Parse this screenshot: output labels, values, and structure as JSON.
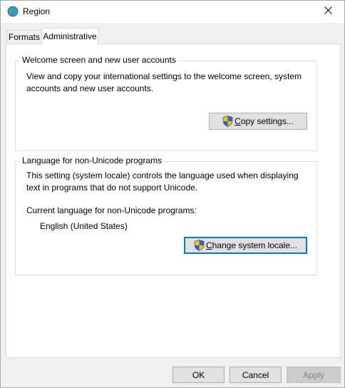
{
  "window": {
    "title": "Region",
    "icon": "globe-icon",
    "close_icon": "close-icon"
  },
  "tabs": [
    {
      "label": "Formats",
      "selected": false
    },
    {
      "label": "Administrative",
      "selected": true
    }
  ],
  "welcome_group": {
    "legend": "Welcome screen and new user accounts",
    "description_line1": "View and copy your international settings to the welcome screen, system",
    "description_line2": "accounts and new user accounts.",
    "copy_button_label": "Copy settings...",
    "copy_button_icon": "uac-shield-icon"
  },
  "language_group": {
    "legend": "Language for non-Unicode programs",
    "description_line1": "This setting (system locale) controls the language used when displaying",
    "description_line2": "text in programs that do not support Unicode.",
    "current_label": "Current language for non-Unicode programs:",
    "current_value": "English (United States)",
    "change_button_label": "Change system locale...",
    "change_button_icon": "uac-shield-icon"
  },
  "footer": {
    "ok_label": "OK",
    "cancel_label": "Cancel",
    "apply_label": "Apply",
    "apply_enabled": false
  },
  "colors": {
    "focus_border": "#0078d7",
    "button_face": "#e1e1e1",
    "dialog_background": "#f0f0f0"
  }
}
